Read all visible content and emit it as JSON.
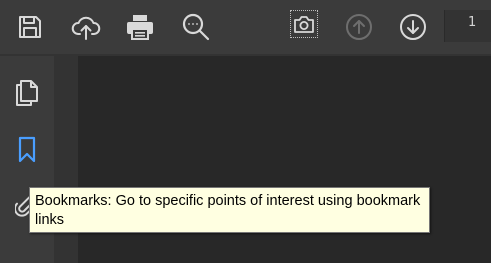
{
  "toolbar": {
    "buttons": [
      {
        "icon": "save-icon"
      },
      {
        "icon": "upload-cloud-icon"
      },
      {
        "icon": "print-icon"
      },
      {
        "icon": "find-icon"
      },
      {
        "icon": "camera-icon"
      },
      {
        "icon": "arrow-up-circle-icon"
      },
      {
        "icon": "arrow-down-circle-icon"
      }
    ],
    "page_number": "1"
  },
  "sidebar": {
    "items": [
      {
        "icon": "pages-icon"
      },
      {
        "icon": "bookmark-icon",
        "active_color": "#4a9eff"
      },
      {
        "icon": "paperclip-icon"
      }
    ]
  },
  "tooltip": {
    "text": "Bookmarks: Go to specific points of interest using bookmark links"
  },
  "colors": {
    "toolbar_bg": "#3b3b3b",
    "canvas_bg": "#282828",
    "icon": "#d9d9d9",
    "icon_disabled": "#6e6e6e",
    "accent": "#4a9eff",
    "tooltip_bg": "#ffffe1"
  }
}
